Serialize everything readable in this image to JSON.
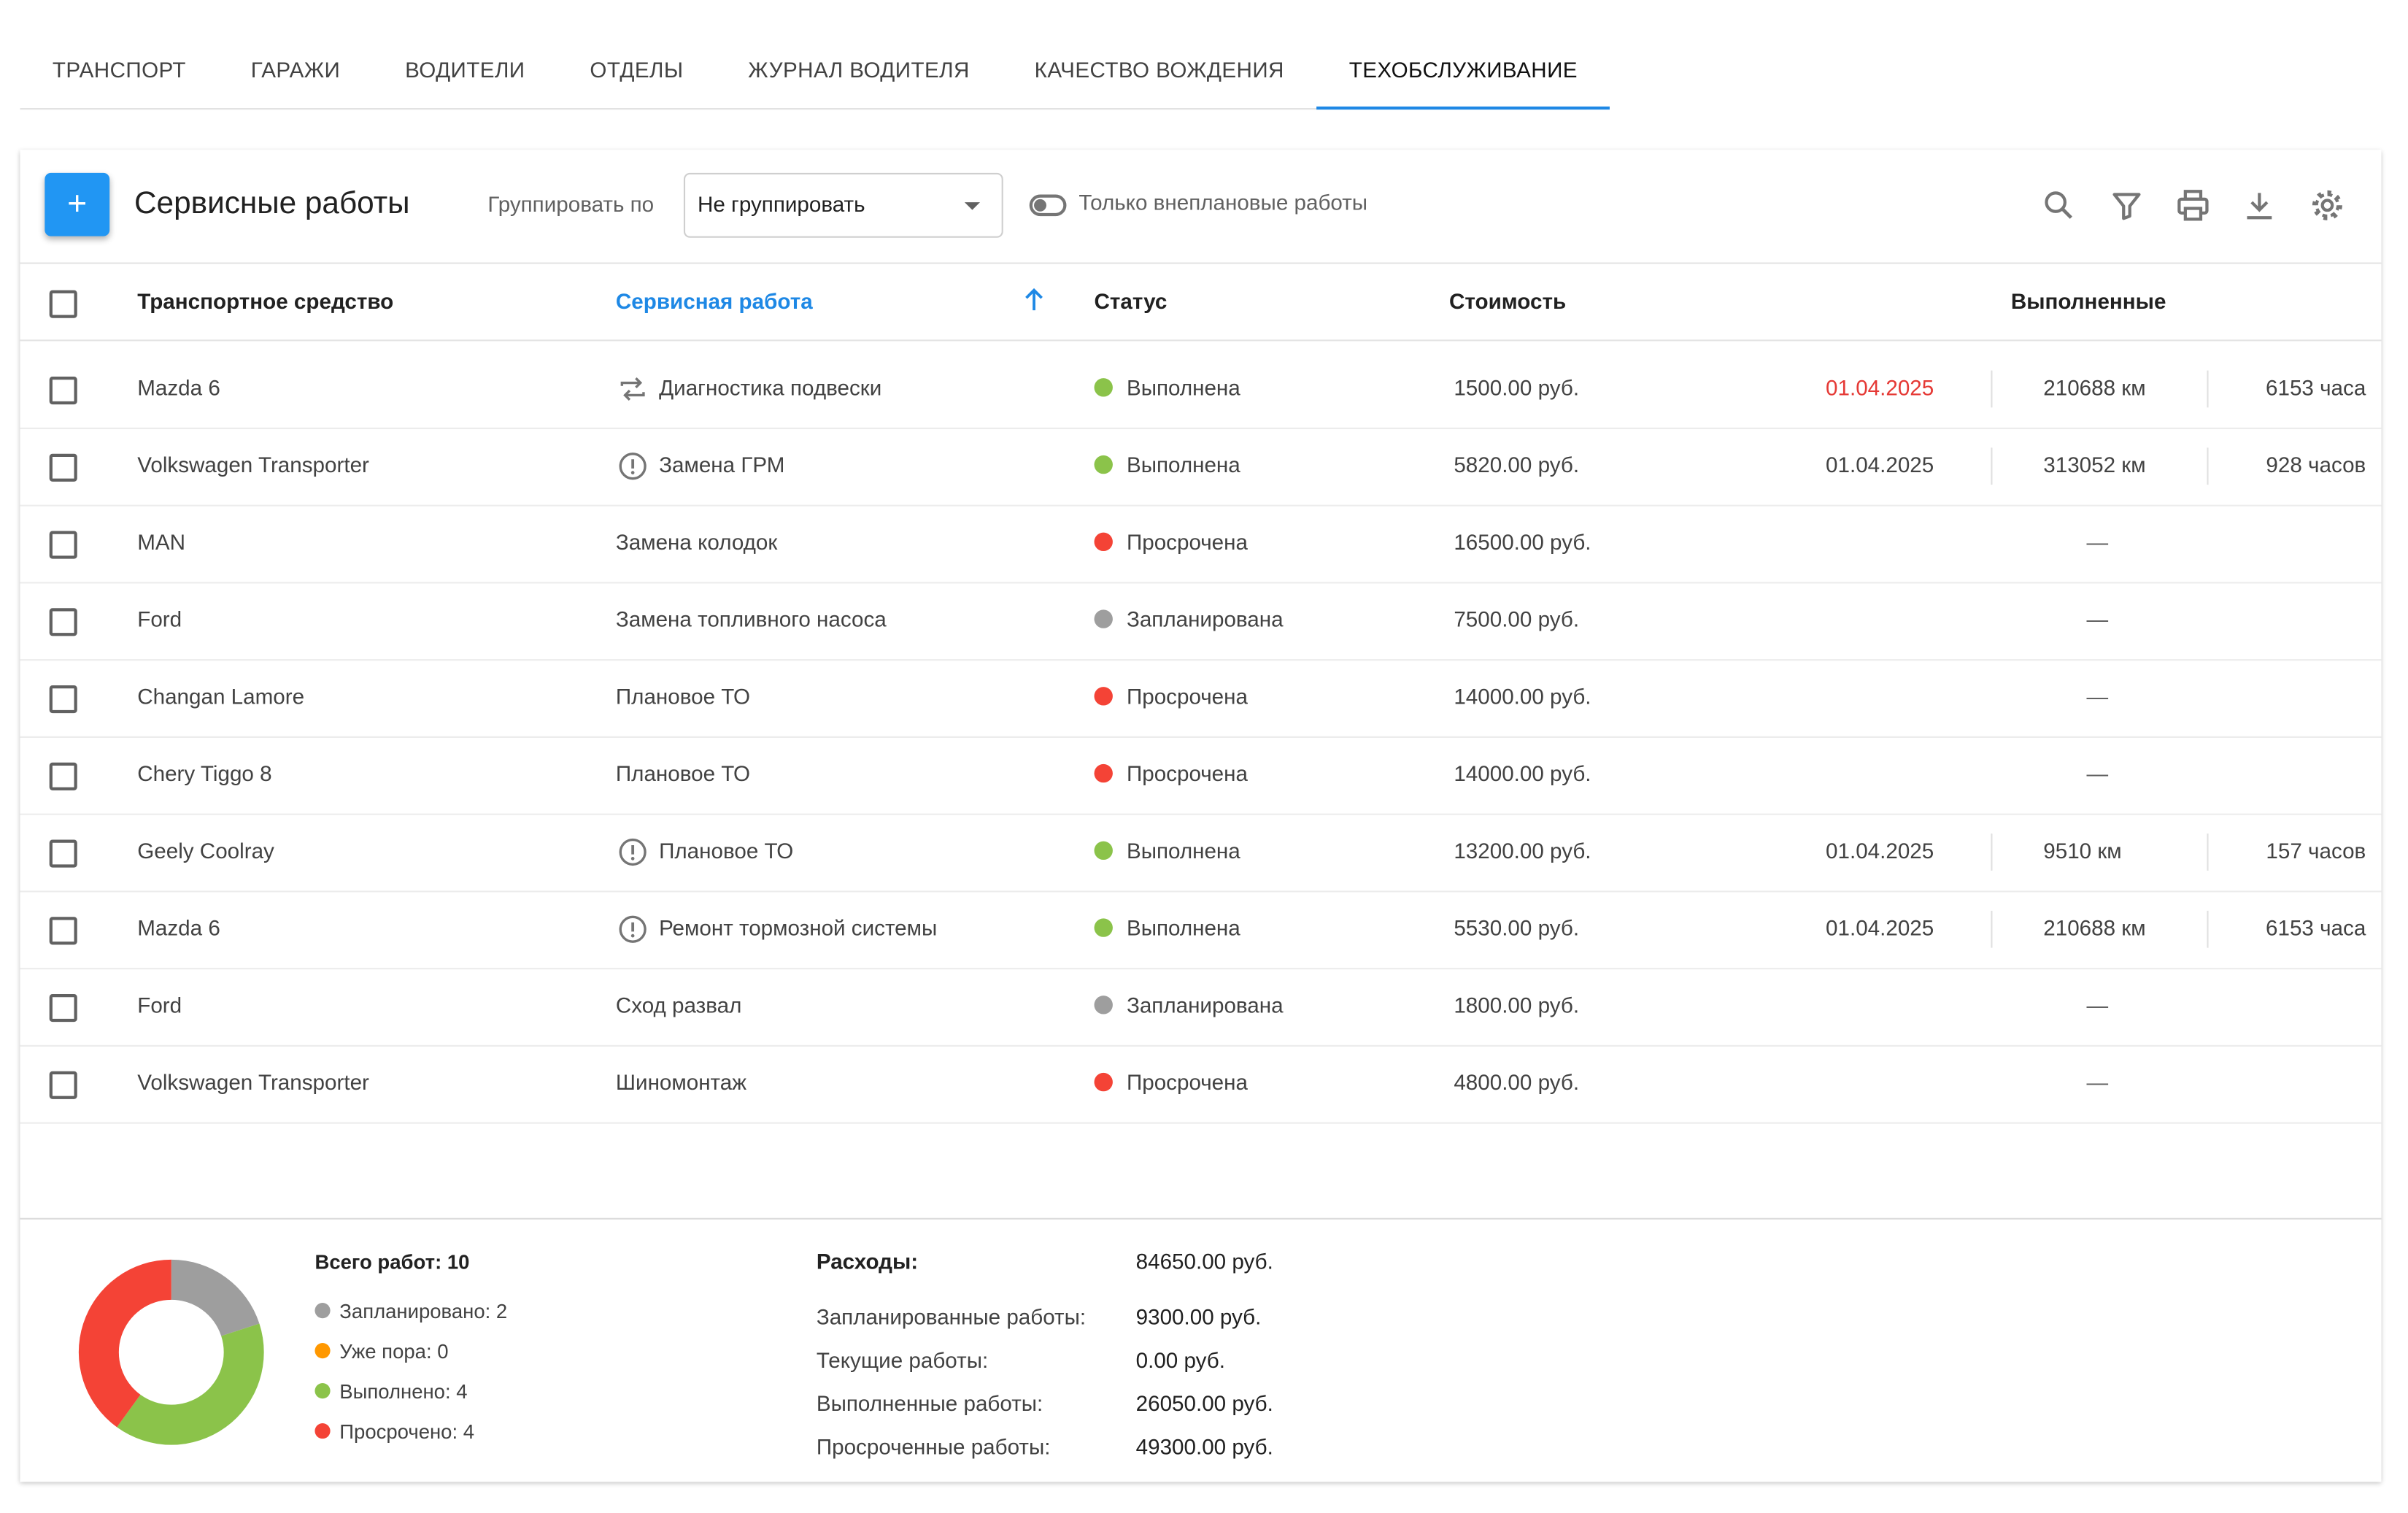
{
  "tabs": [
    "ТРАНСПОРТ",
    "ГАРАЖИ",
    "ВОДИТЕЛИ",
    "ОТДЕЛЫ",
    "ЖУРНАЛ ВОДИТЕЛЯ",
    "КАЧЕСТВО ВОЖДЕНИЯ",
    "ТЕХОБСЛУЖИВАНИЕ"
  ],
  "active_tab": "ТЕХОБСЛУЖИВАНИЕ",
  "toolbar": {
    "add_label": "+",
    "title": "Сервисные работы",
    "group_label": "Группировать по",
    "group_value": "Не группировать",
    "toggle_label": "Только внеплановые работы",
    "toggle_on": false,
    "icons": [
      "search-icon",
      "filter-icon",
      "print-icon",
      "download-icon",
      "settings-icon"
    ]
  },
  "columns": {
    "vehicle": "Транспортное средство",
    "service": "Сервисная работа",
    "status": "Статус",
    "cost": "Стоимость",
    "done": "Выполненные"
  },
  "colors": {
    "accent": "#2196f3",
    "status_done": "#8bc34a",
    "status_overdue": "#f44336",
    "status_planned": "#9e9e9e",
    "status_due": "#ff9800"
  },
  "rows": [
    {
      "vehicle": "Mazda 6",
      "icon": "repeat-icon",
      "service": "Диагностика подвески",
      "status": "Выполнена",
      "status_color": "#8bc34a",
      "cost": "1500.00 руб.",
      "date": "01.04.2025",
      "date_overdue": true,
      "km": "210688 км",
      "hours": "6153 часа"
    },
    {
      "vehicle": "Volkswagen Transporter",
      "icon": "alert-circle-icon",
      "service": "Замена ГРМ",
      "status": "Выполнена",
      "status_color": "#8bc34a",
      "cost": "5820.00 руб.",
      "date": "01.04.2025",
      "date_overdue": false,
      "km": "313052 км",
      "hours": "928 часов"
    },
    {
      "vehicle": "MAN",
      "icon": "",
      "service": "Замена колодок",
      "status": "Просрочена",
      "status_color": "#f44336",
      "cost": "16500.00 руб.",
      "dash": "—"
    },
    {
      "vehicle": "Ford",
      "icon": "",
      "service": "Замена топливного насоса",
      "status": "Запланирована",
      "status_color": "#9e9e9e",
      "cost": "7500.00 руб.",
      "dash": "—"
    },
    {
      "vehicle": "Changan Lamore",
      "icon": "",
      "service": "Плановое ТО",
      "status": "Просрочена",
      "status_color": "#f44336",
      "cost": "14000.00 руб.",
      "dash": "—"
    },
    {
      "vehicle": "Chery Tiggo 8",
      "icon": "",
      "service": "Плановое ТО",
      "status": "Просрочена",
      "status_color": "#f44336",
      "cost": "14000.00 руб.",
      "dash": "—"
    },
    {
      "vehicle": "Geely Coolray",
      "icon": "alert-circle-icon",
      "service": "Плановое ТО",
      "status": "Выполнена",
      "status_color": "#8bc34a",
      "cost": "13200.00 руб.",
      "date": "01.04.2025",
      "date_overdue": false,
      "km": "9510 км",
      "hours": "157 часов"
    },
    {
      "vehicle": "Mazda 6",
      "icon": "alert-circle-icon",
      "service": "Ремонт тормозной системы",
      "status": "Выполнена",
      "status_color": "#8bc34a",
      "cost": "5530.00 руб.",
      "date": "01.04.2025",
      "date_overdue": false,
      "km": "210688 км",
      "hours": "6153 часа"
    },
    {
      "vehicle": "Ford",
      "icon": "",
      "service": "Сход развал",
      "status": "Запланирована",
      "status_color": "#9e9e9e",
      "cost": "1800.00 руб.",
      "dash": "—"
    },
    {
      "vehicle": "Volkswagen Transporter",
      "icon": "",
      "service": "Шиномонтаж",
      "status": "Просрочена",
      "status_color": "#f44336",
      "cost": "4800.00 руб.",
      "dash": "—"
    }
  ],
  "summary": {
    "total_label": "Всего работ: 10",
    "legend": [
      {
        "label": "Запланировано: 2",
        "color": "#9e9e9e",
        "value": 2
      },
      {
        "label": "Уже пора: 0",
        "color": "#ff9800",
        "value": 0
      },
      {
        "label": "Выполнено: 4",
        "color": "#8bc34a",
        "value": 4
      },
      {
        "label": "Просрочено: 4",
        "color": "#f44336",
        "value": 4
      }
    ],
    "expenses": [
      {
        "label": "Расходы:",
        "value": "84650.00 руб."
      },
      {
        "label": "Запланированные работы:",
        "value": "9300.00 руб."
      },
      {
        "label": "Текущие работы:",
        "value": "0.00 руб."
      },
      {
        "label": "Выполненные работы:",
        "value": "26050.00 руб."
      },
      {
        "label": "Просроченные работы:",
        "value": "49300.00 руб."
      }
    ]
  }
}
